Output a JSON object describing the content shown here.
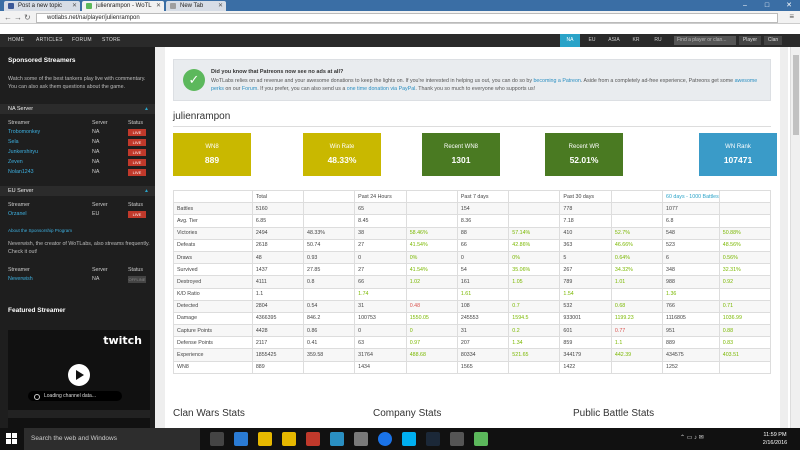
{
  "browser": {
    "tabs": [
      {
        "label": "Post a new topic",
        "favicon_color": "#3b5998"
      },
      {
        "label": "julienrampon - WoTL",
        "favicon_color": "#5cb85c"
      },
      {
        "label": "New Tab",
        "favicon_color": "#9e9e9e"
      }
    ],
    "url": "wotlabs.net/na/player/julienrampon",
    "window_controls": [
      "–",
      "□",
      "✕"
    ]
  },
  "site_nav": {
    "links": [
      "HOME",
      "ARTICLES",
      "FORUM",
      "STORE"
    ],
    "regions": [
      "NA",
      "EU",
      "ASIA",
      "KR",
      "RU"
    ],
    "active_region": "NA",
    "search_placeholder": "Find a player or clan...",
    "player_btn": "Player",
    "clan_btn": "Clan"
  },
  "sidebar": {
    "title": "Sponsored Streamers",
    "intro": "Watch some of the best tankers play live with commentary. You can also ask them questions about the game.",
    "na_server": {
      "label": "NA Server",
      "columns": [
        "Streamer",
        "Server",
        "Status"
      ],
      "rows": [
        {
          "name": "Trobomonkey",
          "server": "NA",
          "status": "LIVE"
        },
        {
          "name": "Sela",
          "server": "NA",
          "status": "LIVE"
        },
        {
          "name": "Junkershiryu",
          "server": "NA",
          "status": "LIVE"
        },
        {
          "name": "Zeven",
          "server": "NA",
          "status": "LIVE"
        },
        {
          "name": "Nolan1243",
          "server": "NA",
          "status": "LIVE"
        }
      ]
    },
    "eu_server": {
      "label": "EU Server",
      "columns": [
        "Streamer",
        "Server",
        "Status"
      ],
      "rows": [
        {
          "name": "Orzanel",
          "server": "EU",
          "status": "LIVE"
        }
      ]
    },
    "sponsorship_link": "About the Sponsorship Program",
    "creator_text": "Neverwish, the creator of WoTLabs, also streams frequently. Check it out!",
    "creator_table": {
      "columns": [
        "Streamer",
        "Server",
        "Status"
      ],
      "rows": [
        {
          "name": "Neverwish",
          "server": "NA",
          "status": "OFFLINE"
        }
      ]
    },
    "featured_title": "Featured Streamer",
    "twitch_logo": "twitch",
    "loading_text": "Loading channel data..."
  },
  "notice": {
    "title": "Did you know that Patreons now see no ads at all?",
    "body_parts": [
      "WoTLabs relies on ad revenue and your awesome donations to keep the lights on. If you're interested in helping us out, you can do so by ",
      "becoming a Patreon",
      ". Aside from a completely ad-free experience, Patreons get some ",
      "awesome perks",
      " on our ",
      "Forum",
      ". If you prefer, you can also send us a ",
      "one time donation via PayPal",
      ". Thank you so much to everyone who supports us!"
    ]
  },
  "player_name": "julienrampon",
  "stat_boxes": [
    {
      "label": "WN8",
      "value": "889",
      "color": "#c9b800"
    },
    {
      "label": "Win Rate",
      "value": "48.33%",
      "color": "#c9b800"
    },
    {
      "label": "Recent WN8",
      "value": "1301",
      "color": "#4a7a22"
    },
    {
      "label": "Recent WR",
      "value": "52.01%",
      "color": "#4a7a22"
    },
    {
      "label": "WN Rank",
      "value": "107471",
      "color": "#3a9bc8"
    }
  ],
  "stats_table": {
    "headers": [
      "",
      "Total",
      "",
      "Past 24 Hours",
      "",
      "Past 7 days",
      "",
      "Past 30 days",
      "",
      "60 days - 1000 Battles",
      ""
    ],
    "rows": [
      [
        "Battles",
        "5160",
        "",
        "65",
        "",
        "154",
        "",
        "778",
        "",
        "1077",
        ""
      ],
      [
        "Avg. Tier",
        "6.85",
        "",
        "8.45",
        "",
        "8.36",
        "",
        "7.18",
        "",
        "6.8",
        ""
      ],
      [
        "Victories",
        "2494",
        "48.33%",
        "38",
        "58.46%",
        "88",
        "57.14%",
        "410",
        "52.7%",
        "548",
        "50.88%"
      ],
      [
        "Defeats",
        "2618",
        "50.74",
        "27",
        "41.54%",
        "66",
        "42.86%",
        "363",
        "46.66%",
        "523",
        "48.56%"
      ],
      [
        "Draws",
        "48",
        "0.93",
        "0",
        "0%",
        "0",
        "0%",
        "5",
        "0.64%",
        "6",
        "0.56%"
      ],
      [
        "Survived",
        "1437",
        "27.85",
        "27",
        "41.54%",
        "54",
        "35.06%",
        "267",
        "34.32%",
        "348",
        "32.31%"
      ],
      [
        "Destroyed",
        "4111",
        "0.8",
        "66",
        "1.02",
        "161",
        "1.05",
        "789",
        "1.01",
        "988",
        "0.92"
      ],
      [
        "K/D Ratio",
        "1.1",
        "",
        "1.74",
        "",
        "1.61",
        "",
        "1.54",
        "",
        "1.36",
        ""
      ],
      [
        "Detected",
        "2804",
        "0.54",
        "31",
        "0.48",
        "108",
        "0.7",
        "532",
        "0.68",
        "766",
        "0.71"
      ],
      [
        "Damage",
        "4366395",
        "846.2",
        "100753",
        "1550.05",
        "245553",
        "1594.5",
        "933001",
        "1199.23",
        "1116805",
        "1036.99"
      ],
      [
        "Capture Points",
        "4428",
        "0.86",
        "0",
        "0",
        "31",
        "0.2",
        "601",
        "0.77",
        "951",
        "0.88"
      ],
      [
        "Defense Points",
        "2117",
        "0.41",
        "63",
        "0.97",
        "207",
        "1.34",
        "859",
        "1.1",
        "889",
        "0.83"
      ],
      [
        "Experience",
        "1855425",
        "359.58",
        "31764",
        "488.68",
        "80334",
        "521.65",
        "344179",
        "442.39",
        "434575",
        "403.51"
      ],
      [
        "WN8",
        "889",
        "",
        "1434",
        "",
        "1565",
        "",
        "1422",
        "",
        "1252",
        ""
      ]
    ]
  },
  "sections": [
    "Clan Wars Stats",
    "Company Stats",
    "Public Battle Stats"
  ],
  "taskbar": {
    "search_text": "Search the web and Windows",
    "time": "11:59 PM",
    "date": "2/16/2016",
    "app_colors": [
      "#444",
      "#2a7bd4",
      "#e6b800",
      "#e6b800",
      "#c0392b",
      "#2a8fc2",
      "#7a7a7a",
      "#1a73e8",
      "#00aff0",
      "#1b2838",
      "#555",
      "#5cb85c"
    ]
  }
}
